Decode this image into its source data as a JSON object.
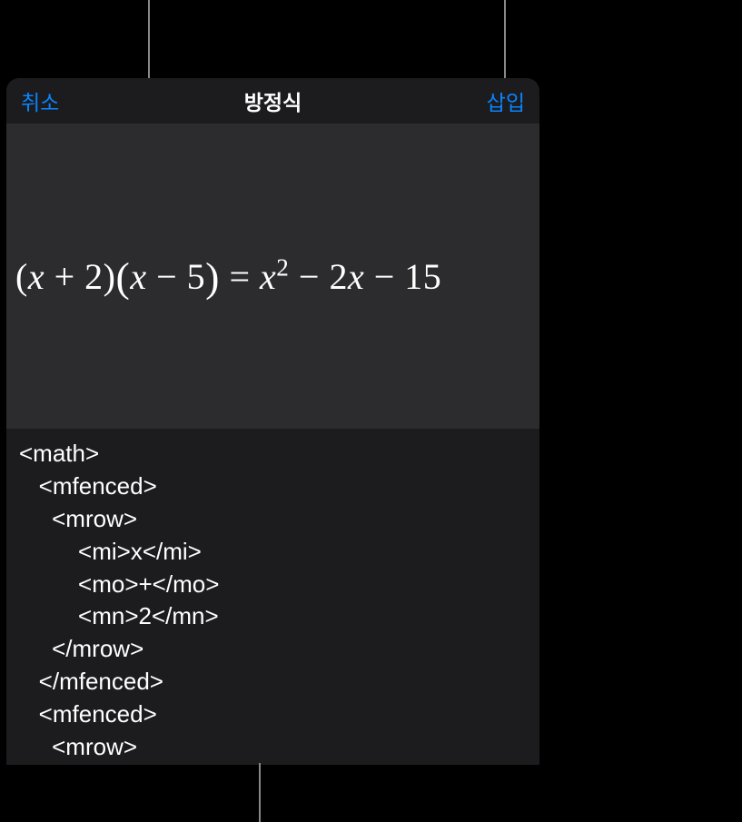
{
  "header": {
    "cancel_label": "취소",
    "title": "방정식",
    "insert_label": "삽입"
  },
  "equation": {
    "preview_parts": {
      "lp1": "(",
      "x1": "x",
      "plus": " + ",
      "two": "2",
      "rp1": ")",
      "lp2": "(",
      "x2": "x",
      "minus1": " − ",
      "five": "5",
      "rp2": ")",
      "equals": " = ",
      "x3": "x",
      "sup2": "2",
      "minus2": " − ",
      "twox": "2",
      "x4": "x",
      "minus3": " − ",
      "fifteen": "15"
    }
  },
  "code": {
    "line1": "<math>",
    "line2": "   <mfenced>",
    "line3": "     <mrow>",
    "line4": "         <mi>x</mi>",
    "line5": "         <mo>+</mo>",
    "line6": "         <mn>2</mn>",
    "line7": "     </mrow>",
    "line8": "   </mfenced>",
    "line9": "   <mfenced>",
    "line10": "     <mrow>"
  }
}
